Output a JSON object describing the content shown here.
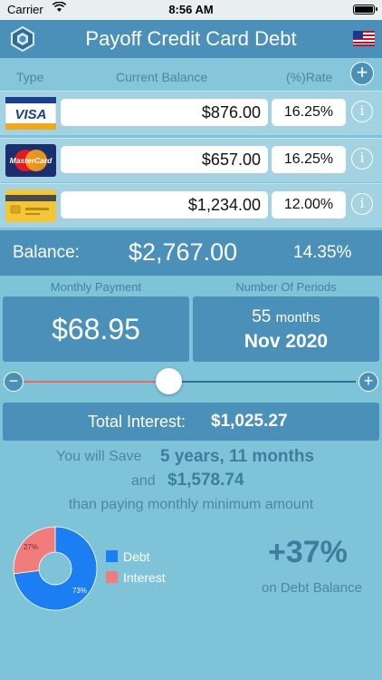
{
  "status": {
    "carrier": "Carrier",
    "time": "8:56 AM"
  },
  "nav": {
    "title": "Payoff Credit Card Debt"
  },
  "table_header": {
    "type": "Type",
    "balance": "Current Balance",
    "rate": "(%)Rate"
  },
  "cards": [
    {
      "brand": "VISA",
      "balance": "$876.00",
      "rate": "16.25%"
    },
    {
      "brand": "MasterCard",
      "balance": "$657.00",
      "rate": "16.25%"
    },
    {
      "brand": "generic",
      "balance": "$1,234.00",
      "rate": "12.00%"
    }
  ],
  "summary": {
    "label": "Balance:",
    "value": "$2,767.00",
    "rate": "14.35%"
  },
  "payment": {
    "label": "Monthly Payment",
    "value": "$68.95"
  },
  "periods": {
    "label": "Number Of Periods",
    "count": "55",
    "unit": "months",
    "end": "Nov 2020"
  },
  "slider": {
    "value_fraction": 0.43
  },
  "interest": {
    "label": "Total Interest:",
    "value": "$1,025.27"
  },
  "savings": {
    "line1": "You will Save",
    "time_saved": "5 years, 11 months",
    "line2": "and",
    "money_saved": "$1,578.74",
    "line3": "than paying monthly minimum amount"
  },
  "chart_data": {
    "type": "pie",
    "series": [
      {
        "name": "Debt",
        "value": 73,
        "label": "73%",
        "color": "#1b7ef2"
      },
      {
        "name": "Interest",
        "value": 27,
        "label": "27%",
        "color": "#f07c7c"
      }
    ]
  },
  "increase": {
    "value": "+37%",
    "caption": "on Debt Balance"
  },
  "colors": {
    "bar": "#4a90b8",
    "background": "#7fc3d9",
    "row": "#a3d3e2"
  }
}
